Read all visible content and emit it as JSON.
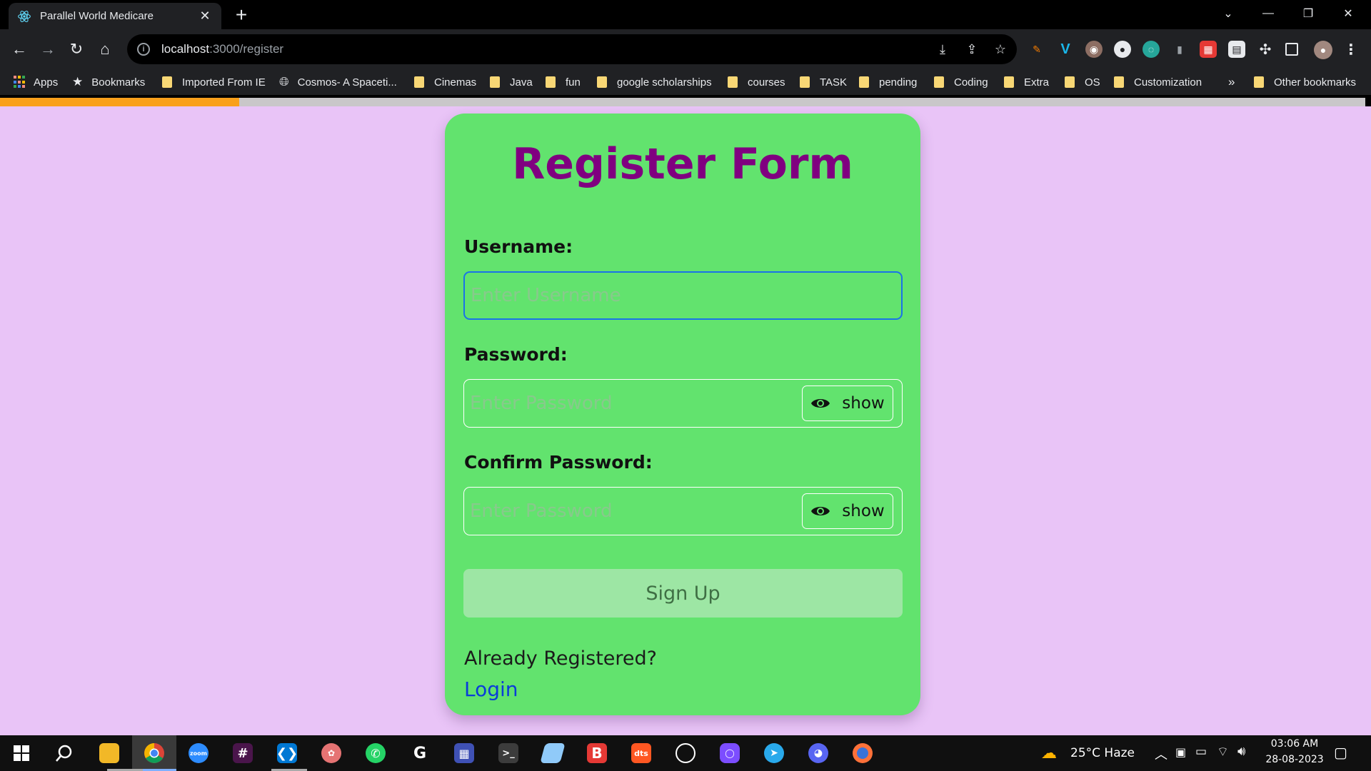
{
  "browser": {
    "tab_title": "Parallel World Medicare",
    "url_host": "localhost",
    "url_path": ":3000/register"
  },
  "bookmarks": [
    {
      "label": "Apps",
      "icon": "apps-grid-icon"
    },
    {
      "label": "Bookmarks",
      "icon": "star-icon"
    },
    {
      "label": "Imported From IE",
      "icon": "folder-icon"
    },
    {
      "label": "Cosmos- A Spaceti...",
      "icon": "globe-icon"
    },
    {
      "label": "Cinemas",
      "icon": "folder-icon"
    },
    {
      "label": "Java",
      "icon": "folder-icon"
    },
    {
      "label": "fun",
      "icon": "folder-icon"
    },
    {
      "label": "google scholarships",
      "icon": "folder-icon"
    },
    {
      "label": "courses",
      "icon": "folder-icon"
    },
    {
      "label": "TASK",
      "icon": "folder-icon"
    },
    {
      "label": "pending",
      "icon": "folder-icon"
    },
    {
      "label": "Coding",
      "icon": "folder-icon"
    },
    {
      "label": "Extra",
      "icon": "folder-icon"
    },
    {
      "label": "OS",
      "icon": "folder-icon"
    },
    {
      "label": "Customization",
      "icon": "folder-icon"
    }
  ],
  "bookmarks_overflow": "»",
  "other_bookmarks": "Other bookmarks",
  "page_load_progress": 0.175,
  "colors": {
    "page_bg": "#e9c4f7",
    "card_bg": "#62e36e",
    "title": "#800080",
    "link": "#0a3dd9",
    "button_disabled": "#9de6a4",
    "progress": "#f9a01b"
  },
  "form": {
    "title": "Register Form",
    "username_label": "Username:",
    "username_placeholder": "Enter Username",
    "password_label": "Password:",
    "password_placeholder": "Enter Password",
    "confirm_label": "Confirm Password:",
    "confirm_placeholder": "Enter Password",
    "show_label": "show",
    "submit_label": "Sign Up",
    "already_text": "Already Registered?",
    "login_link": "Login"
  },
  "taskbar": {
    "weather": "25°C  Haze",
    "time": "03:06 AM",
    "date": "28-08-2023",
    "apps": [
      "start-icon",
      "search-icon",
      "file-explorer-icon",
      "chrome-icon",
      "zoom-icon",
      "slack-icon",
      "vscode-icon",
      "paint-icon",
      "whatsapp-icon",
      "grammarly-icon",
      "calculator-icon",
      "terminal-icon",
      "eraser-icon",
      "b-app-icon",
      "dts-icon",
      "obs-icon",
      "purple-app-icon",
      "telegram-icon",
      "discord-icon",
      "firefox-icon"
    ]
  }
}
